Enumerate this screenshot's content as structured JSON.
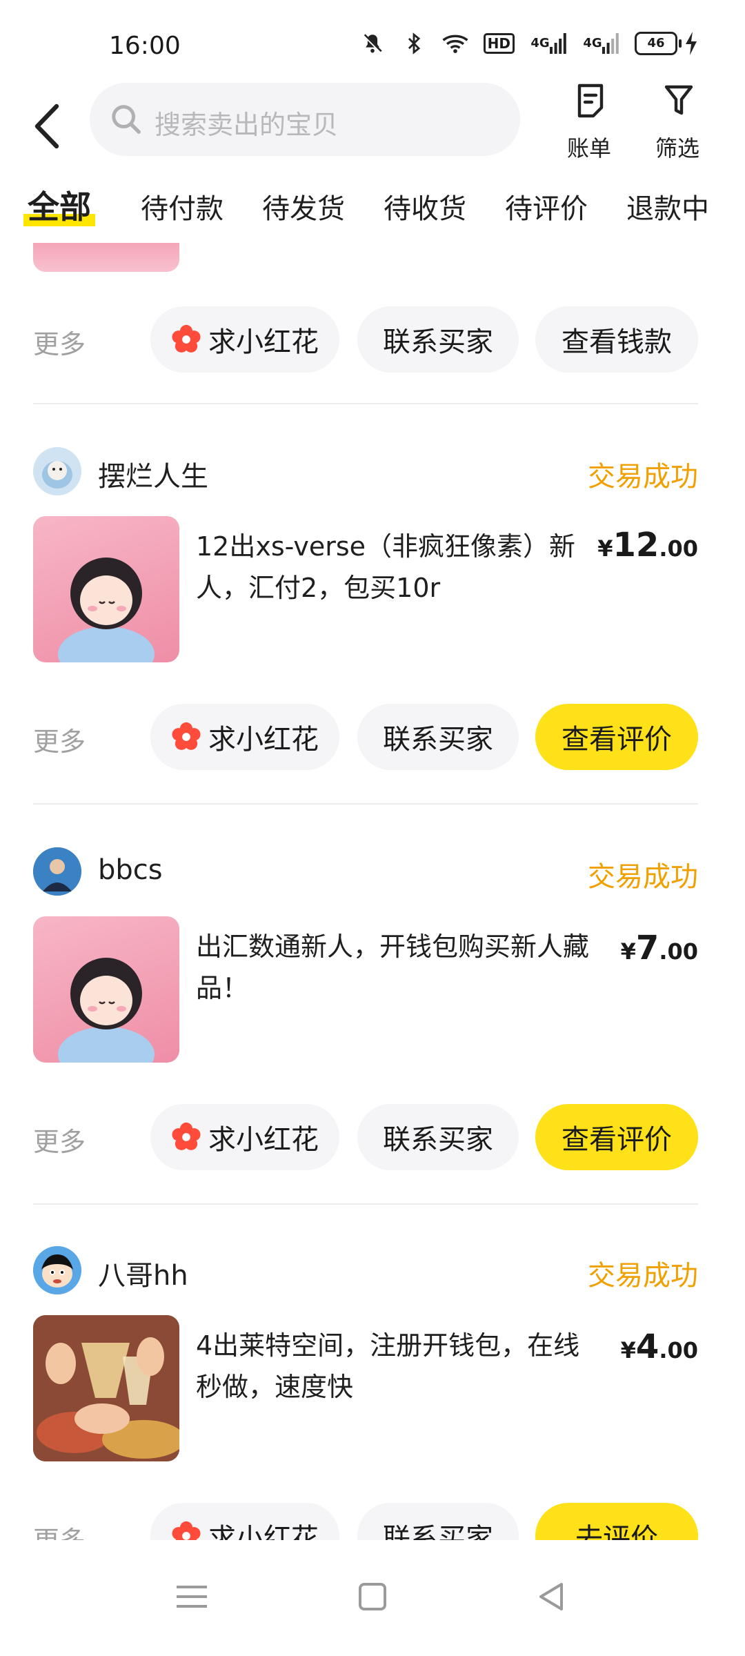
{
  "status_bar": {
    "time": "16:00",
    "network_hd": "HD",
    "signal_1": "4G",
    "signal_2": "4G",
    "battery": "46"
  },
  "header": {
    "search_placeholder": "搜索卖出的宝贝",
    "bill_label": "账单",
    "filter_label": "筛选"
  },
  "tabs": [
    {
      "label": "全部",
      "active": true
    },
    {
      "label": "待付款"
    },
    {
      "label": "待发货"
    },
    {
      "label": "待收货"
    },
    {
      "label": "待评价"
    },
    {
      "label": "退款中"
    }
  ],
  "common": {
    "more_label": "更多",
    "flower_label": "求小红花",
    "contact_label": "联系买家"
  },
  "top_partial": {
    "right_button": "查看钱款"
  },
  "orders": [
    {
      "username": "摆烂人生",
      "status": "交易成功",
      "title": "12出xs-verse（非疯狂像素）新人，汇付2，包买10r",
      "price_symbol": "¥",
      "price_int": "12",
      "price_dec": ".00",
      "right_button": "查看评价"
    },
    {
      "username": "bbcs",
      "status": "交易成功",
      "title": "出汇数通新人，开钱包购买新人藏品！",
      "price_symbol": "¥",
      "price_int": "7",
      "price_dec": ".00",
      "right_button": "查看评价"
    },
    {
      "username": "八哥hh",
      "status": "交易成功",
      "title": "4出莱特空间，注册开钱包，在线秒做，速度快",
      "price_symbol": "¥",
      "price_int": "4",
      "price_dec": ".00",
      "right_button": "去评价"
    }
  ],
  "colors": {
    "accent_yellow": "#ffe11a",
    "status_orange": "#f0a000",
    "flower_red": "#ff4b3a"
  }
}
